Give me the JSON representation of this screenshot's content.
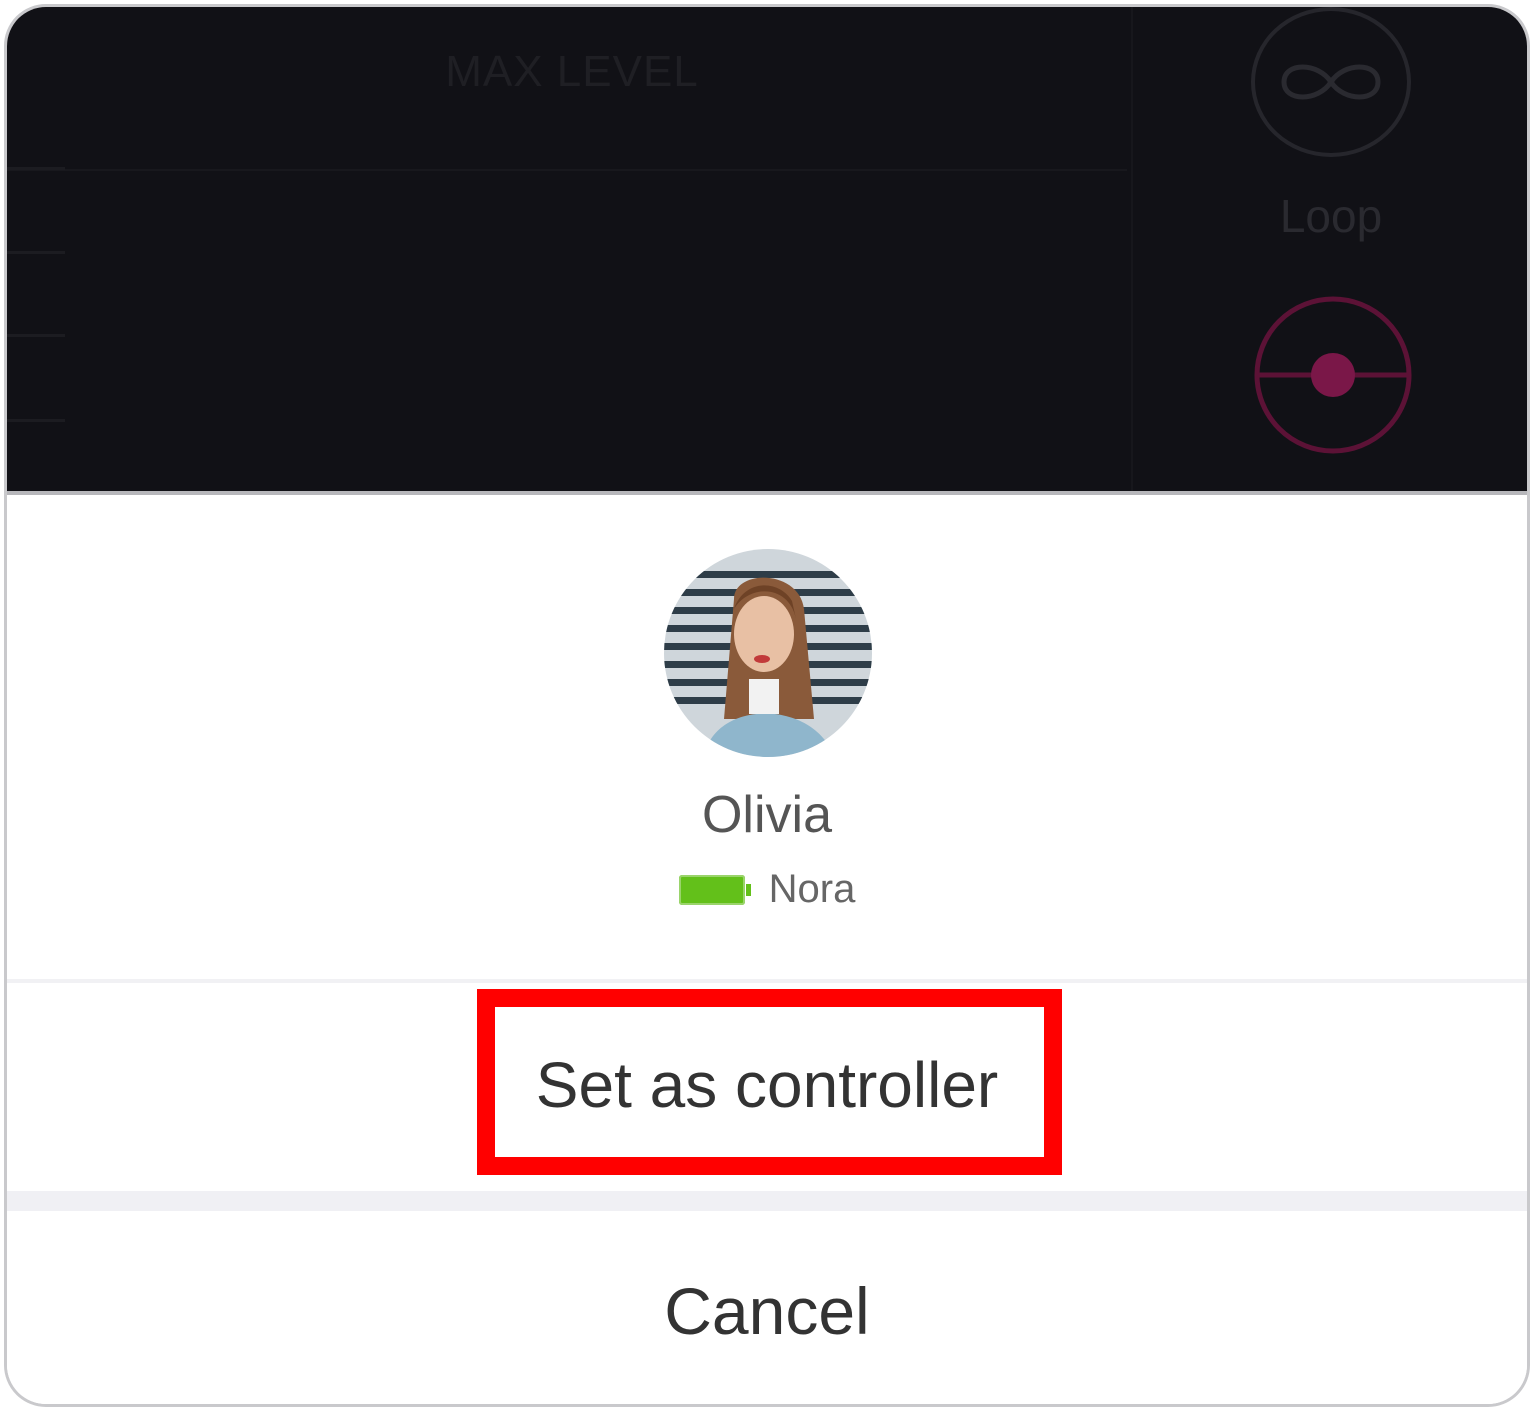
{
  "background": {
    "max_level_label": "MAX LEVEL",
    "loop_label": "Loop",
    "accent_color": "#8a1a4f"
  },
  "sheet": {
    "user_name": "Olivia",
    "device_name": "Nora",
    "battery_color": "#63c01a",
    "set_controller_label": "Set as controller",
    "cancel_label": "Cancel"
  }
}
